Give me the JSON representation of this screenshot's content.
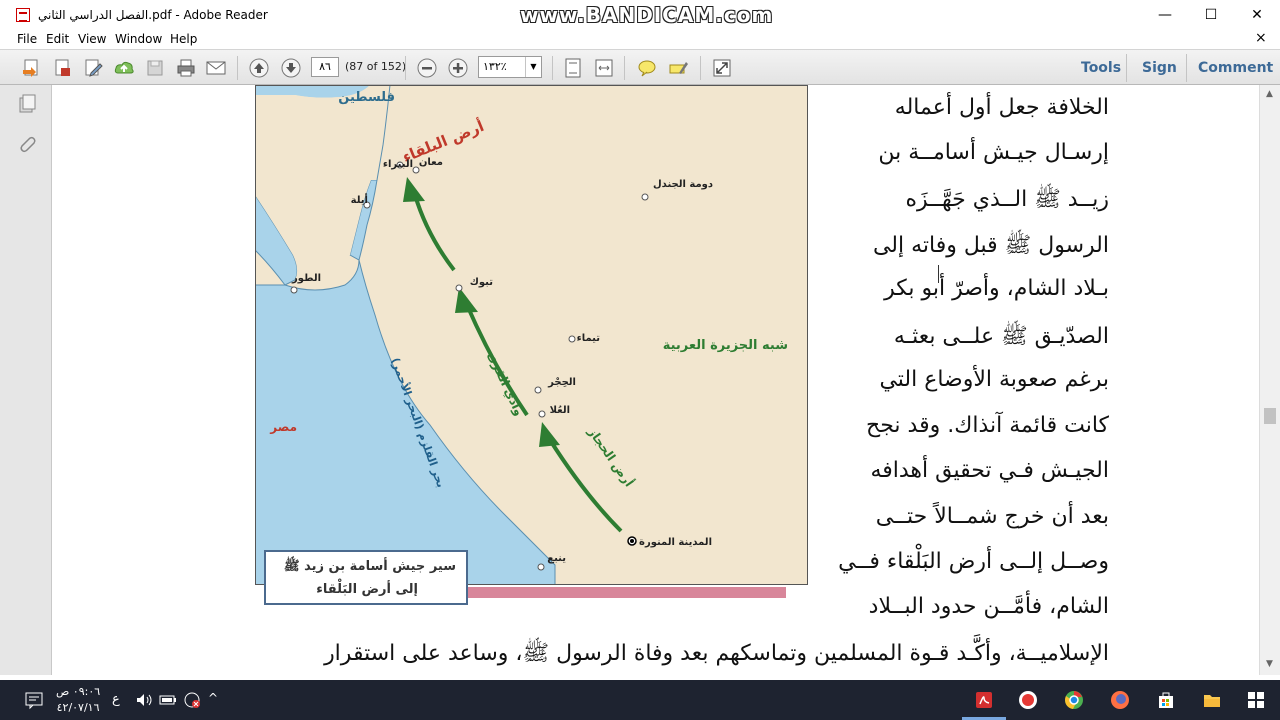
{
  "window": {
    "title": "الفصل الدراسي الثاني.pdf - Adobe Reader",
    "watermark": "www.BANDICAM.com",
    "controls": {
      "minimize": "—",
      "maximize": "☐",
      "close": "✕"
    }
  },
  "menu": {
    "items": [
      "File",
      "Edit",
      "View",
      "Window",
      "Help"
    ],
    "close": "×"
  },
  "toolbar": {
    "page_input": "٨٦",
    "page_count": "(87 of 152)",
    "zoom": "١٣٢٪",
    "tools_label": "Tools",
    "sign_label": "Sign",
    "comment_label": "Comment"
  },
  "map": {
    "labels": {
      "palestine": "فلسطين",
      "balqa": "أرض البلقاء",
      "maan": "معان",
      "petra": "البتراء",
      "ayla": "أيلة",
      "dumat": "دومة الجندل",
      "tur": "الطور",
      "tabuk": "تبوك",
      "tayma": "تيماء",
      "peninsula": "شبه الجزيرة العربية",
      "hijr": "الحِجْر",
      "ula": "العُلا",
      "wadi_qura": "وادي القرى",
      "hijaz": "أرض الحجاز",
      "egypt": "مصر",
      "red_sea": "بحر القلزم (البحر الأحمر)",
      "medina": "المدينة المنورة",
      "yanbu": "ينبع"
    },
    "caption_line1": "سير جيش أسامة بن زيد ﷺ",
    "caption_line2": "إلى أرض البَلْقاء"
  },
  "text": {
    "lines": [
      "الخلافة جعل أول أعماله",
      "إرسـال جيـش أسامــة بن",
      "زيــد ﷺ الــذي جَهَّــزَه",
      "الرسول ﷺ قبل وفاته إلى",
      "بـلاد الشام، وأصرّ أبو بكر",
      "الصدّيـق ﷺ علــى بعثـه",
      "برغم صعوبة الأوضاع التي",
      "كانت قائمة آنذاك. وقد نجح",
      "الجيـش فـي تحقيق أهدافه",
      "بعد أن خرج شمــالاً حتــى",
      "وصــل إلــى أرض البَلْقاء فــي",
      "الشام، فأمَّــن حدود البــلاد"
    ],
    "bottom_line": "الإسلاميــة، وأكَّـد قـوة المسلمين وتماسكهم بعد وفاة الرسول ﷺ، وساعد على استقرار"
  },
  "taskbar": {
    "time": "٠٩:٠٦ ص",
    "date": "٤٢/٠٧/١٦",
    "lang": "ع"
  }
}
